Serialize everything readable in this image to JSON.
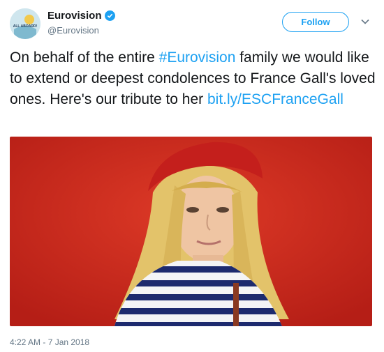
{
  "account": {
    "display_name": "Eurovision",
    "handle": "@Eurovision",
    "avatar_text": "ALL ABOARD!"
  },
  "follow_label": "Follow",
  "tweet": {
    "text_before": "On behalf of the entire ",
    "hashtag": "#Eurovision",
    "text_middle": " family we would like to extend or deepest condolences to France Gall's loved ones. Here's our tribute to her ",
    "link": "bit.ly/ESCFranceGall"
  },
  "timestamp": "4:22 AM - 7 Jan 2018",
  "icons": {
    "verified": "verified-badge-icon",
    "caret": "chevron-down-icon"
  },
  "colors": {
    "accent": "#1da1f2",
    "photo_background": "#cc2a1f",
    "beret": "#c41f1c"
  }
}
